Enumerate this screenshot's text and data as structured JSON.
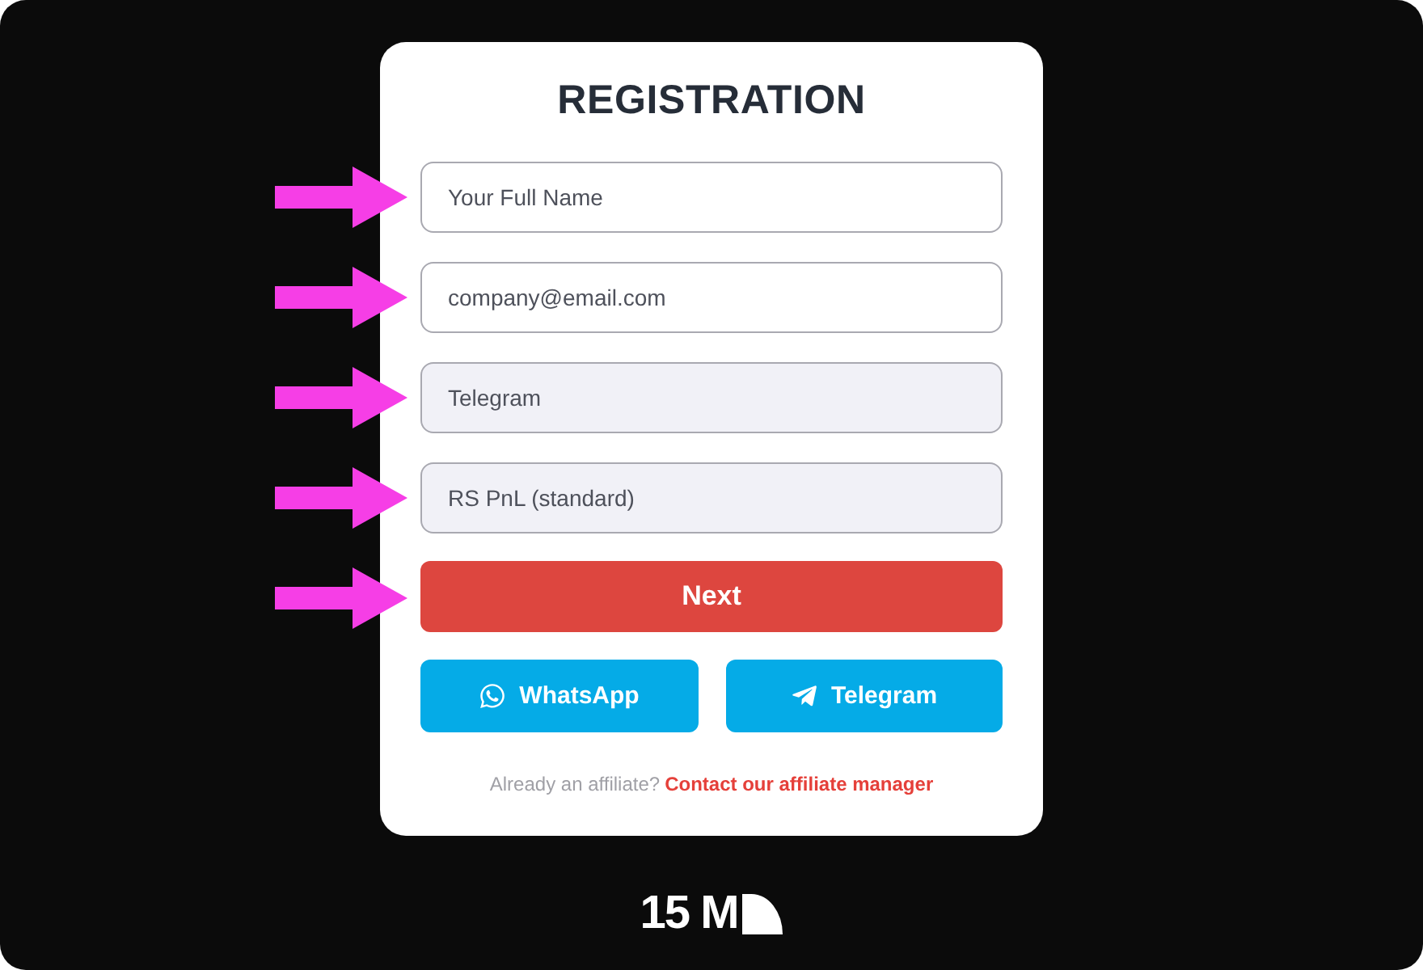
{
  "title": "REGISTRATION",
  "fields": [
    {
      "kind": "text",
      "placeholder": "Your Full Name",
      "arrow": true
    },
    {
      "kind": "text",
      "placeholder": "company@email.com",
      "arrow": true
    },
    {
      "kind": "select",
      "value": "Telegram",
      "arrow": true
    },
    {
      "kind": "select",
      "value": "RS PnL (standard)",
      "arrow": true
    }
  ],
  "submit": {
    "label": "Next",
    "arrow": true
  },
  "social_buttons": [
    {
      "kind": "whatsapp",
      "label": "WhatsApp"
    },
    {
      "kind": "telegram",
      "label": "Telegram"
    }
  ],
  "footer": {
    "text": "Already an affiliate?",
    "link": "Contact our affiliate manager"
  },
  "logo": {
    "text": "15 M"
  }
}
